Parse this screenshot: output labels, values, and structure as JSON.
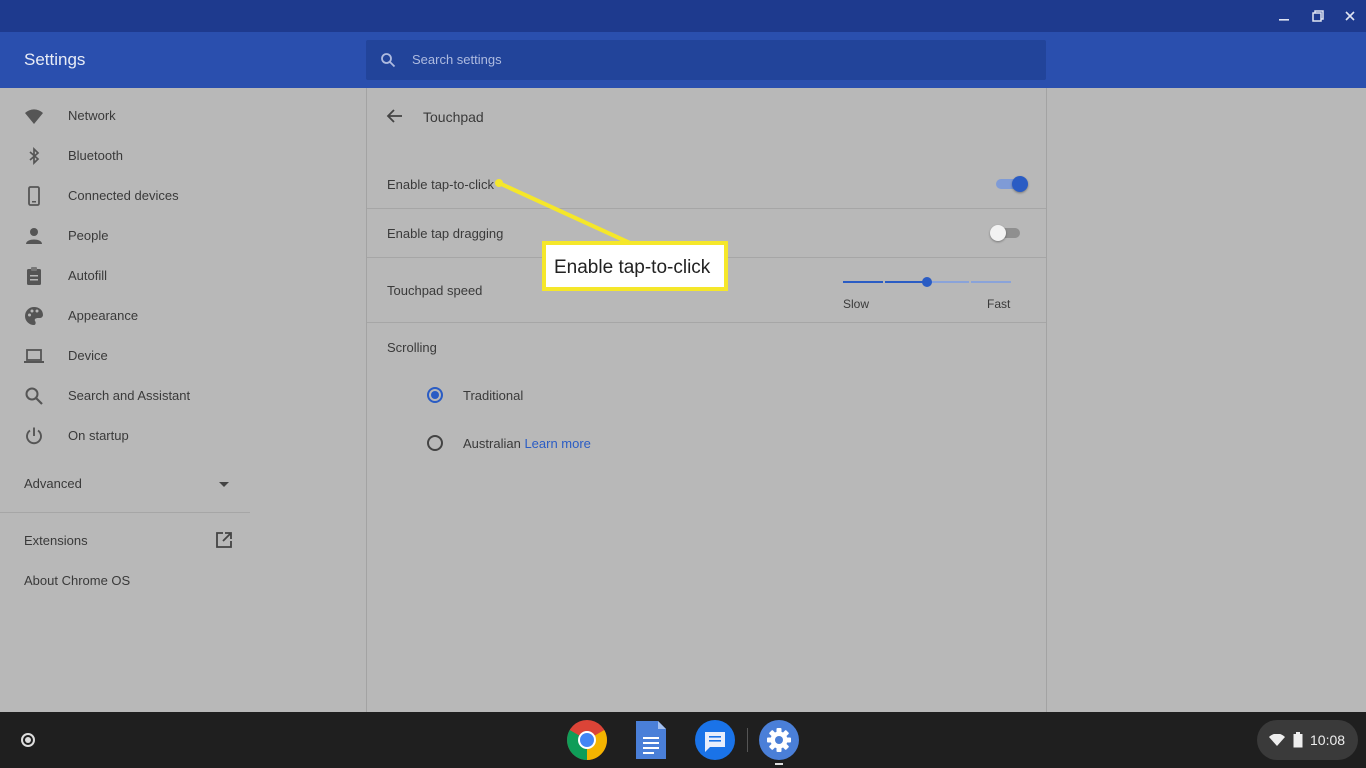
{
  "window": {
    "minimize_icon": "minimize-icon",
    "restore_icon": "restore-icon",
    "close_icon": "close-icon"
  },
  "header": {
    "title": "Settings",
    "search_placeholder": "Search settings"
  },
  "sidebar": {
    "items": [
      {
        "label": "Network",
        "icon": "wifi-icon"
      },
      {
        "label": "Bluetooth",
        "icon": "bluetooth-icon"
      },
      {
        "label": "Connected devices",
        "icon": "phone-icon"
      },
      {
        "label": "People",
        "icon": "person-icon"
      },
      {
        "label": "Autofill",
        "icon": "clipboard-icon"
      },
      {
        "label": "Appearance",
        "icon": "palette-icon"
      },
      {
        "label": "Device",
        "icon": "laptop-icon"
      },
      {
        "label": "Search and Assistant",
        "icon": "search-icon"
      },
      {
        "label": "On startup",
        "icon": "power-icon"
      }
    ],
    "advanced_label": "Advanced",
    "extensions_label": "Extensions",
    "about_label": "About Chrome OS"
  },
  "main": {
    "page_title": "Touchpad",
    "tap_to_click": {
      "label": "Enable tap-to-click",
      "enabled": true
    },
    "tap_dragging": {
      "label": "Enable tap dragging",
      "enabled": false
    },
    "touchpad_speed": {
      "label": "Touchpad speed",
      "min_label": "Slow",
      "max_label": "Fast",
      "value_fraction": 0.5
    },
    "scrolling": {
      "label": "Scrolling",
      "options": [
        {
          "label": "Traditional",
          "selected": true
        },
        {
          "label": "Australian",
          "selected": false,
          "link": "Learn more"
        }
      ]
    }
  },
  "annotation": {
    "callout_text": "Enable tap-to-click",
    "color": "#f5e72a"
  },
  "shelf": {
    "apps": [
      "chrome-icon",
      "docs-icon",
      "messages-icon",
      "settings-icon"
    ],
    "clock": "10:08"
  },
  "colors": {
    "accent": "#2a5cc4",
    "appbar": "#2a4fae",
    "titlebar": "#1e3a8e"
  }
}
